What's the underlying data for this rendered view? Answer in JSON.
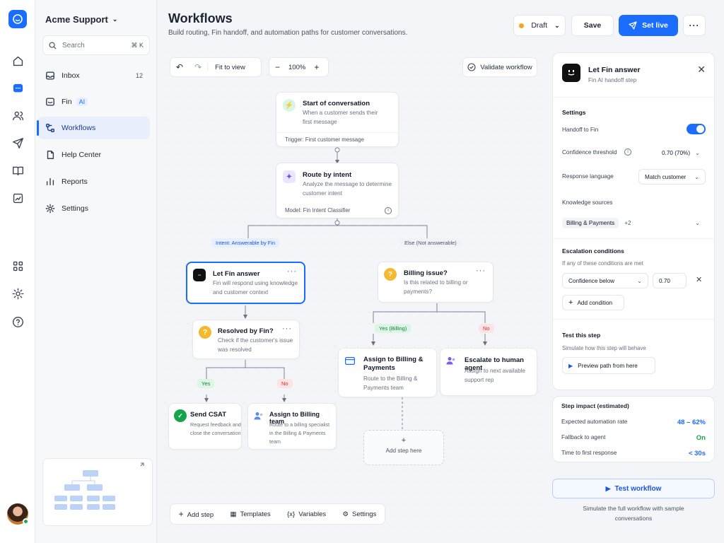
{
  "workspace": {
    "name": "Acme Support"
  },
  "search": {
    "placeholder": "Search",
    "shortcut": "⌘ K"
  },
  "nav": [
    {
      "label": "Inbox",
      "count": "12",
      "icon": "inbox-icon"
    },
    {
      "label": "Fin",
      "badge": "AI",
      "icon": "fin-icon"
    },
    {
      "label": "Workflows",
      "icon": "workflows-icon",
      "active": true
    },
    {
      "label": "Help Center",
      "icon": "book-icon"
    },
    {
      "label": "Reports",
      "icon": "bar-chart-icon"
    },
    {
      "label": "Settings",
      "icon": "gear-icon"
    }
  ],
  "header": {
    "title": "Workflows",
    "subtitle": "Build routing, Fin handoff, and automation paths for customer conversations.",
    "status": "Draft",
    "save": "Save",
    "set_live": "Set live",
    "more": "···"
  },
  "toolbar": {
    "fit": "Fit to view",
    "zoom": "100%",
    "minus": "−",
    "plus": "+",
    "validate": "Validate workflow"
  },
  "nodes": {
    "start": {
      "title": "Start of conversation",
      "desc1": "When a customer sends their",
      "desc2": "first message",
      "trigger": "Trigger: First customer message"
    },
    "route": {
      "title": "Route by intent",
      "desc1": "Analyze the message to determine",
      "desc2": "customer intent",
      "model": "Model: Fin Intent Classifier"
    },
    "fin": {
      "title": "Let Fin answer",
      "desc1": "Fin will respond using knowledge",
      "desc2": "and customer context"
    },
    "billing": {
      "title": "Billing issue?",
      "desc1": "Is this related to billing or",
      "desc2": "payments?"
    },
    "resolved": {
      "title": "Resolved by Fin?",
      "desc1": "Check if the customer's issue",
      "desc2": "was resolved"
    },
    "assign_billing": {
      "title1": "Assign to Billing &",
      "title2": "Payments",
      "desc1": "Route to the Billing &",
      "desc2": "Payments team"
    },
    "escalate": {
      "title": "Escalate to human agent",
      "desc1": "Assign to next available",
      "desc2": "support rep"
    },
    "csat": {
      "title": "Send CSAT",
      "desc1": "Request feedback and",
      "desc2": "close the conversation"
    },
    "assign_team": {
      "title": "Assign to Billing team",
      "desc1": "Route to a billing specialist",
      "desc2": "in the Billing & Payments",
      "desc3": "team"
    },
    "add_step": {
      "label": "Add step here",
      "plus": "+"
    }
  },
  "edges": {
    "answerable": "Intent: Answerable by Fin",
    "else": "Else (Not answerable)",
    "yes_billing": "Yes (Billing)",
    "no": "No",
    "yes": "Yes"
  },
  "bottom": {
    "add_step": "Add step",
    "templates": "Templates",
    "variables": "Variables",
    "settings": "Settings"
  },
  "panel": {
    "title": "Let Fin answer",
    "subtitle": "Fin AI handoff step",
    "settings": "Settings",
    "handoff": "Handoff to Fin",
    "handoff_on": true,
    "confidence": "Confidence threshold",
    "confidence_value": "0.70 (70%)",
    "language": "Response language",
    "language_value": "Match customer",
    "knowledge": "Knowledge sources",
    "knowledge_value": "Billing & Payments",
    "knowledge_more": "+2",
    "escalation": "Escalation conditions",
    "escalation_hint": "If any of these conditions are met",
    "cond_field": "Confidence below",
    "cond_value": "0.70",
    "add_condition": "Add condition",
    "test_title": "Test this step",
    "test_hint": "Simulate how this step will behave",
    "preview": "Preview path from here"
  },
  "impact": {
    "title": "Step impact (estimated)",
    "rows": [
      {
        "label": "Expected automation rate",
        "value": "48 – 62%"
      },
      {
        "label": "Fallback to agent",
        "value": "On"
      },
      {
        "label": "Time to first response",
        "value": "< 30s"
      }
    ]
  },
  "test": {
    "button": "Test workflow",
    "note": "Simulate the full workflow with sample conversations"
  },
  "colors": {
    "accent": "#1a6dff",
    "success": "#16a34a",
    "warning": "#f5b82e",
    "danger": "#e5484d"
  }
}
